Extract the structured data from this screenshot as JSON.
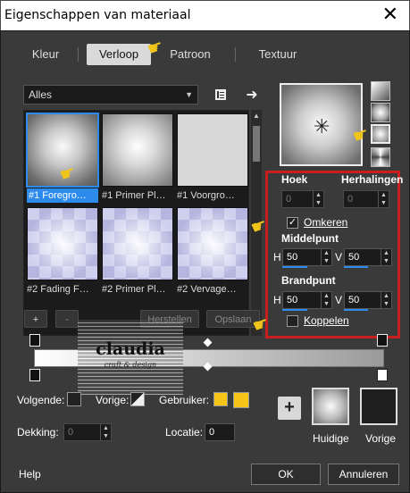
{
  "window": {
    "title": "Eigenschappen van materiaal",
    "close_glyph": "✕"
  },
  "tabs": [
    {
      "label": "Kleur"
    },
    {
      "label": "Verloop",
      "active": true
    },
    {
      "label": "Patroon"
    },
    {
      "label": "Textuur"
    }
  ],
  "category": {
    "selected": "Alles"
  },
  "thumbnails": [
    {
      "label": "#1 Foregro…",
      "selected": true
    },
    {
      "label": "#1 Primer Pl…"
    },
    {
      "label": "#1 Voorgro…"
    },
    {
      "label": "#2 Fading F…"
    },
    {
      "label": "#2 Primer Pl…"
    },
    {
      "label": "#2 Vervage…"
    }
  ],
  "list_buttons": {
    "add": "+",
    "remove": "-",
    "reset": "Herstellen",
    "save": "Opslaan"
  },
  "settings": {
    "hoek_label": "Hoek",
    "hoek_value": "0",
    "herhalingen_label": "Herhalingen",
    "herhalingen_value": "0",
    "omkeren_label": "Omkeren",
    "omkeren_checked": true,
    "middelpunt_label": "Middelpunt",
    "mid_h_label": "H",
    "mid_h_value": "50",
    "mid_v_label": "V",
    "mid_v_value": "50",
    "brandpunt_label": "Brandpunt",
    "focal_h_label": "H",
    "focal_h_value": "50",
    "focal_v_label": "V",
    "focal_v_value": "50",
    "koppelen_label": "Koppelen",
    "koppelen_checked": false
  },
  "watermark": {
    "text": "claudia",
    "subtext": "craft & design"
  },
  "bottom": {
    "volgende_label": "Volgende:",
    "vorige_label": "Vorige:",
    "gebruiker_label": "Gebruiker:",
    "dekking_label": "Dekking:",
    "dekking_value": "0",
    "locatie_label": "Locatie:",
    "locatie_value": "0",
    "huidige_label": "Huidige",
    "vorige_swatch_label": "Vorige"
  },
  "footer": {
    "help": "Help",
    "ok": "OK",
    "cancel": "Annuleren"
  },
  "colors": {
    "accent": "#2d8ceb",
    "highlight_box": "#c81e1e",
    "user_color": "#f5c518",
    "window_bg": "#3a3a3a"
  },
  "icons": [
    "file-list-icon",
    "arrow-right-icon",
    "pointing-hand-icon",
    "plus-icon"
  ]
}
